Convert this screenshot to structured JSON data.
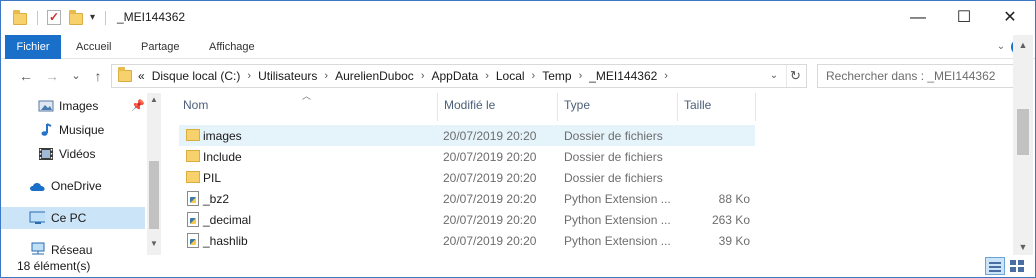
{
  "window": {
    "title": "_MEI144362",
    "controls": {
      "minimize": "—",
      "maximize": "☐",
      "close": "✕"
    }
  },
  "ribbon": {
    "tabs": [
      "Fichier",
      "Accueil",
      "Partage",
      "Affichage"
    ],
    "help": "?"
  },
  "navigation": {
    "back": "←",
    "forward": "→",
    "recent": "⌄",
    "up": "↑",
    "breadcrumbs": [
      "«",
      "Disque local (C:)",
      "Utilisateurs",
      "AurelienDuboc",
      "AppData",
      "Local",
      "Temp",
      "_MEI144362"
    ],
    "search_placeholder": "Rechercher dans : _MEI144362"
  },
  "sidebar": {
    "items": [
      {
        "label": "Images",
        "icon": "images-icon",
        "pinned": true
      },
      {
        "label": "Musique",
        "icon": "music-icon"
      },
      {
        "label": "Vidéos",
        "icon": "videos-icon"
      },
      {
        "label": "OneDrive",
        "icon": "onedrive-icon"
      },
      {
        "label": "Ce PC",
        "icon": "computer-icon",
        "selected": true
      },
      {
        "label": "Réseau",
        "icon": "network-icon"
      }
    ]
  },
  "columns": {
    "name": "Nom",
    "date": "Modifié le",
    "type": "Type",
    "size": "Taille"
  },
  "files": [
    {
      "name": "images",
      "date": "20/07/2019 20:20",
      "type": "Dossier de fichiers",
      "size": "",
      "icon": "folder-icon",
      "hover": true
    },
    {
      "name": "Include",
      "date": "20/07/2019 20:20",
      "type": "Dossier de fichiers",
      "size": "",
      "icon": "folder-icon"
    },
    {
      "name": "PIL",
      "date": "20/07/2019 20:20",
      "type": "Dossier de fichiers",
      "size": "",
      "icon": "folder-icon"
    },
    {
      "name": "_bz2",
      "date": "20/07/2019 20:20",
      "type": "Python Extension ...",
      "size": "88 Ko",
      "icon": "python-extension-icon"
    },
    {
      "name": "_decimal",
      "date": "20/07/2019 20:20",
      "type": "Python Extension ...",
      "size": "263 Ko",
      "icon": "python-extension-icon"
    },
    {
      "name": "_hashlib",
      "date": "20/07/2019 20:20",
      "type": "Python Extension ...",
      "size": "39 Ko",
      "icon": "python-extension-icon"
    }
  ],
  "status": {
    "count": "18 élément(s)"
  },
  "colors": {
    "accent": "#1a6fc9",
    "selection": "#cce4f7",
    "hover": "#e5f3fb",
    "folder": "#f7d26c"
  }
}
